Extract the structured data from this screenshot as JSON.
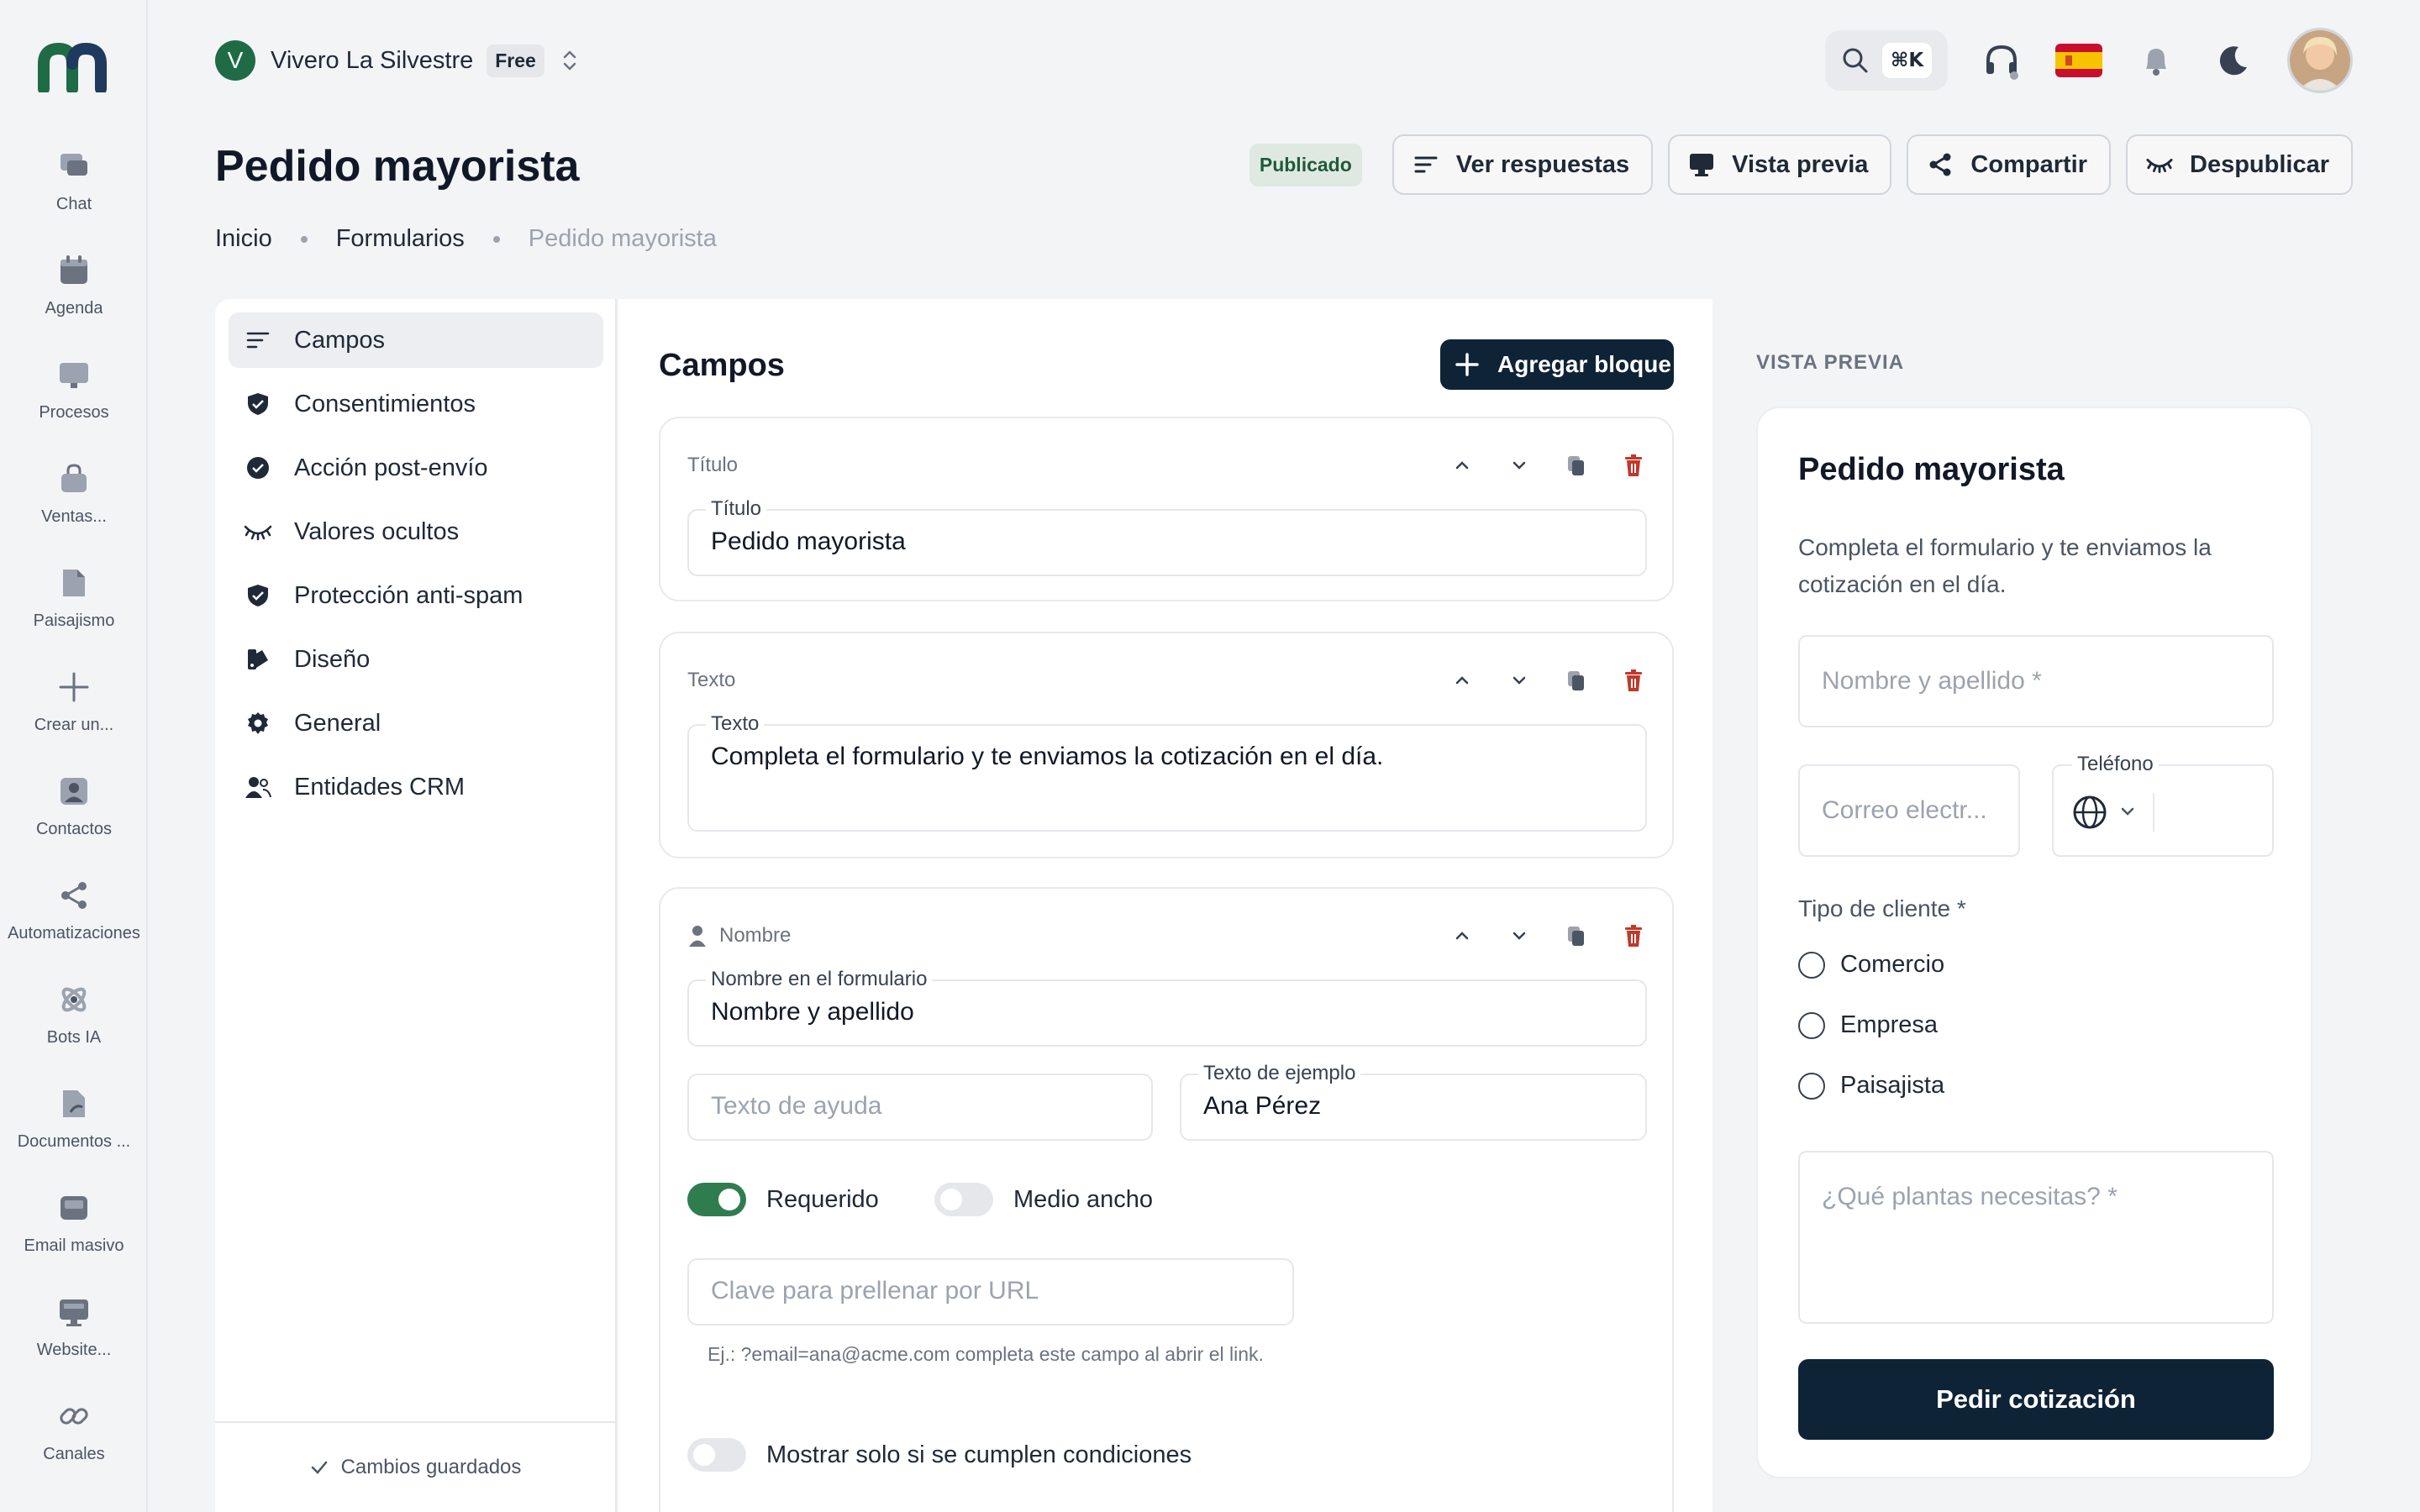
{
  "rail": {
    "items": [
      {
        "label": "Chat",
        "icon": "chat-icon"
      },
      {
        "label": "Agenda",
        "icon": "calendar-icon"
      },
      {
        "label": "Procesos",
        "icon": "board-icon"
      },
      {
        "label": "Ventas...",
        "icon": "bag-icon"
      },
      {
        "label": "Paisajismo",
        "icon": "file-icon"
      },
      {
        "label": "Crear un...",
        "icon": "plus-icon"
      },
      {
        "label": "Contactos",
        "icon": "contact-icon"
      },
      {
        "label": "Automatizaciones",
        "icon": "share-icon"
      },
      {
        "label": "Bots IA",
        "icon": "atom-icon"
      },
      {
        "label": "Documentos ...",
        "icon": "document-icon"
      },
      {
        "label": "Email masivo",
        "icon": "inbox-icon"
      },
      {
        "label": "Website...",
        "icon": "monitor-icon"
      },
      {
        "label": "Canales",
        "icon": "link-icon"
      }
    ]
  },
  "workspace": {
    "initial": "V",
    "name": "Vivero La Silvestre",
    "plan": "Free"
  },
  "topbar": {
    "shortcut": "⌘K"
  },
  "page": {
    "title": "Pedido mayorista",
    "status": "Publicado",
    "actions": {
      "responses": "Ver respuestas",
      "preview": "Vista previa",
      "share": "Compartir",
      "unpublish": "Despublicar"
    },
    "breadcrumb": [
      "Inicio",
      "Formularios",
      "Pedido mayorista"
    ]
  },
  "settings_nav": {
    "items": [
      {
        "label": "Campos",
        "icon": "lines-icon"
      },
      {
        "label": "Consentimientos",
        "icon": "shield-check-icon"
      },
      {
        "label": "Acción post-envío",
        "icon": "check-circle-icon"
      },
      {
        "label": "Valores ocultos",
        "icon": "eye-closed-icon"
      },
      {
        "label": "Protección anti-spam",
        "icon": "shield-check-icon"
      },
      {
        "label": "Diseño",
        "icon": "palette-icon"
      },
      {
        "label": "General",
        "icon": "gear-icon"
      },
      {
        "label": "Entidades CRM",
        "icon": "users-icon"
      }
    ],
    "saved": "Cambios guardados"
  },
  "editor": {
    "title": "Campos",
    "add_block": "Agregar bloque",
    "cards": {
      "title_card": {
        "type": "Título",
        "field_label": "Título",
        "field_value": "Pedido mayorista"
      },
      "text_card": {
        "type": "Texto",
        "field_label": "Texto",
        "field_value": "Completa el formulario y te enviamos la cotización en el día."
      },
      "name_card": {
        "type": "Nombre",
        "label_field": {
          "label": "Nombre en el formulario",
          "value": "Nombre y apellido"
        },
        "help_placeholder": "Texto de ayuda",
        "example_field": {
          "label": "Texto de ejemplo",
          "value": "Ana Pérez"
        },
        "required": {
          "label": "Requerido",
          "on": true
        },
        "half_width": {
          "label": "Medio ancho",
          "on": false
        },
        "url_key_placeholder": "Clave para prellenar por URL",
        "url_hint": "Ej.: ?email=ana@acme.com completa este campo al abrir el link.",
        "conditions": {
          "label": "Mostrar solo si se cumplen condiciones",
          "on": false
        }
      }
    }
  },
  "preview": {
    "label": "VISTA PREVIA",
    "title": "Pedido mayorista",
    "description": "Completa el formulario y te enviamos la cotización en el día.",
    "name_placeholder": "Nombre y apellido *",
    "email_placeholder": "Correo electr...",
    "phone_label": "Teléfono",
    "client_type_label": "Tipo de cliente *",
    "options": [
      "Comercio",
      "Empresa",
      "Paisajista"
    ],
    "plants_placeholder": "¿Qué plantas necesitas? *",
    "submit": "Pedir cotización"
  },
  "colors": {
    "accent_dark": "#0f2336",
    "brand_green": "#1f6b45",
    "toggle_on": "#2f7d4f",
    "delete_red": "#c0392b"
  }
}
